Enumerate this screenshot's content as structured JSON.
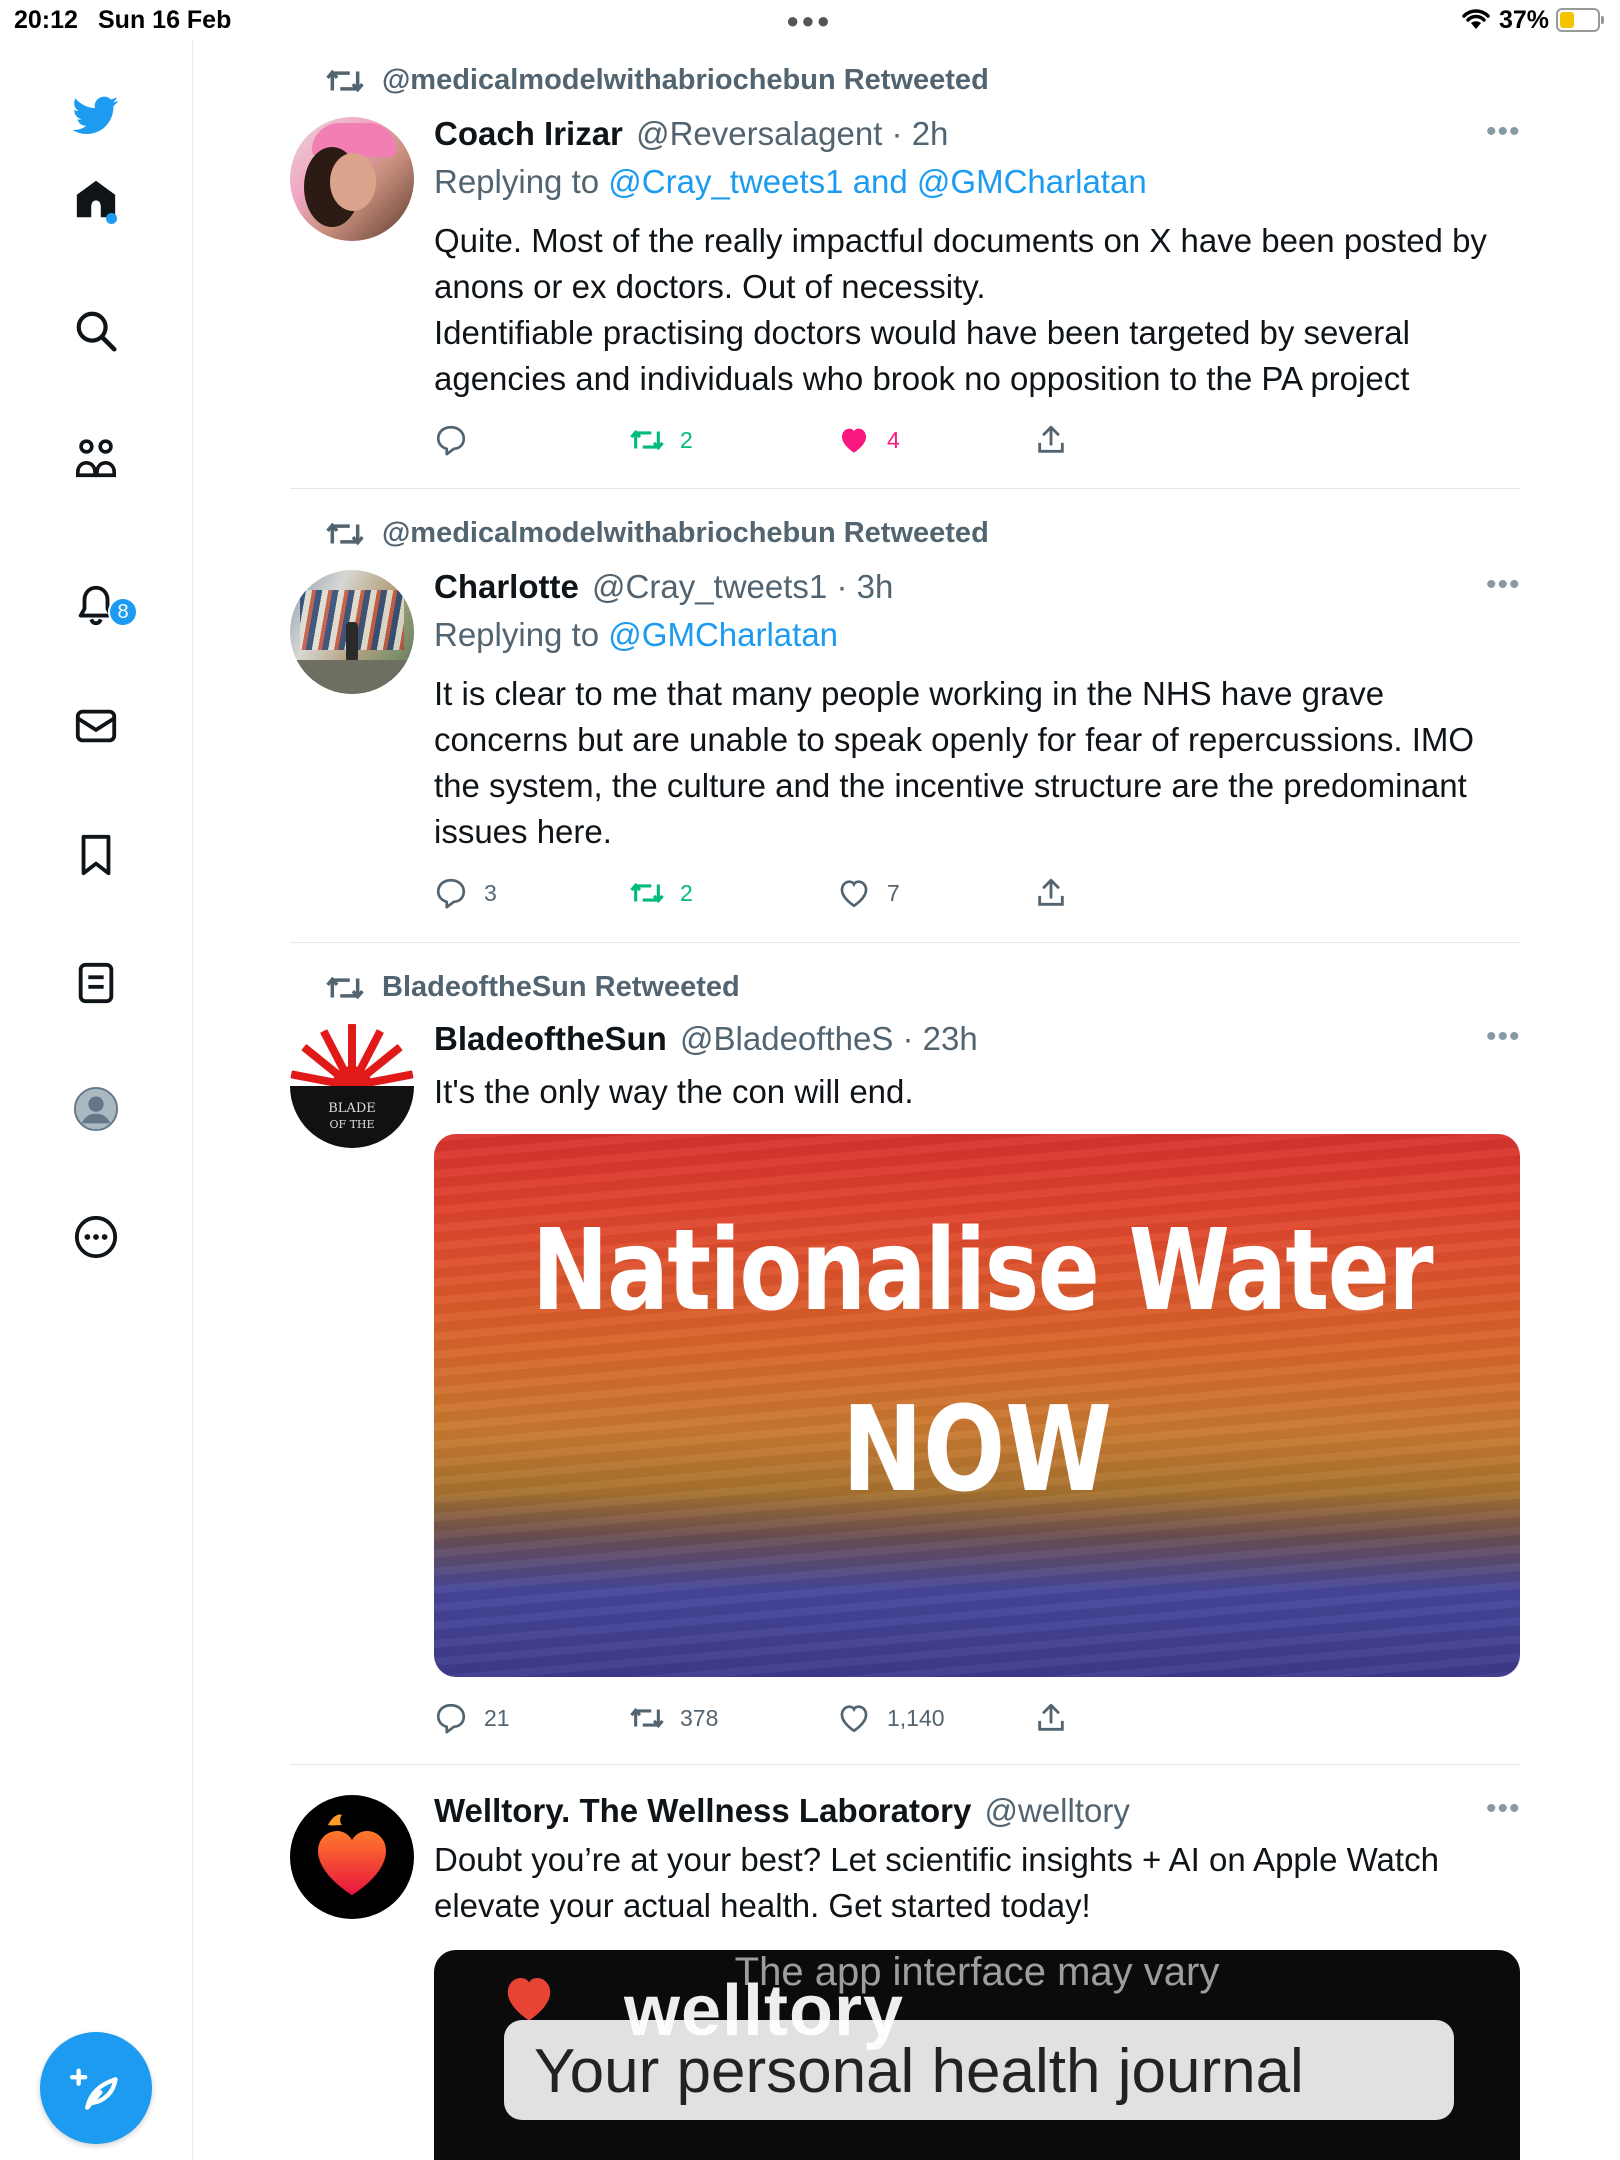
{
  "status": {
    "time": "20:12",
    "date": "Sun 16 Feb",
    "battery": "37%"
  },
  "nav": {
    "notifications_badge": "8"
  },
  "tweets": [
    {
      "retweeted_by": "@medicalmodelwithabriochebun Retweeted",
      "name": "Coach Irizar",
      "handle_time": "@Reversalagent · 2h",
      "replying_prefix": "Replying to",
      "replying_links": "@Cray_tweets1 and @GMCharlatan",
      "text": "Quite. Most of the really impactful documents on X have been posted by anons or ex doctors. Out of necessity.\nIdentifiable practising doctors would have been targeted by several agencies and individuals who brook no opposition to the PA project",
      "replies": "",
      "retweets": "2",
      "likes": "4"
    },
    {
      "retweeted_by": "@medicalmodelwithabriochebun Retweeted",
      "name": "Charlotte",
      "handle_time": "@Cray_tweets1 · 3h",
      "replying_prefix": "Replying to",
      "replying_links": "@GMCharlatan",
      "text": "It is clear to me that many people working in the NHS have grave concerns but are unable to speak openly for fear of repercussions. IMO the system, the culture and the incentive structure are the predominant issues here.",
      "replies": "3",
      "retweets": "2",
      "likes": "7"
    },
    {
      "retweeted_by": "BladeoftheSun Retweeted",
      "name": "BladeoftheSun",
      "handle_time": "@BladeoftheS · 23h",
      "text": "It's the only way the con will end.",
      "image_line1": "Nationalise Water",
      "image_line2": "NOW",
      "avatar_text1": "BLADE",
      "avatar_text2": "OF THE",
      "replies": "21",
      "retweets": "378",
      "likes": "1,140"
    },
    {
      "name": "Welltory. The Wellness Laboratory",
      "handle_time": "@welltory",
      "text": "Doubt you’re at your best? Let scientific insights + AI on Apple Watch elevate your actual health. Get started today!",
      "video_caption": "The app interface may vary",
      "video_logo": "welltory",
      "video_tagline": "Your personal health journal"
    }
  ]
}
